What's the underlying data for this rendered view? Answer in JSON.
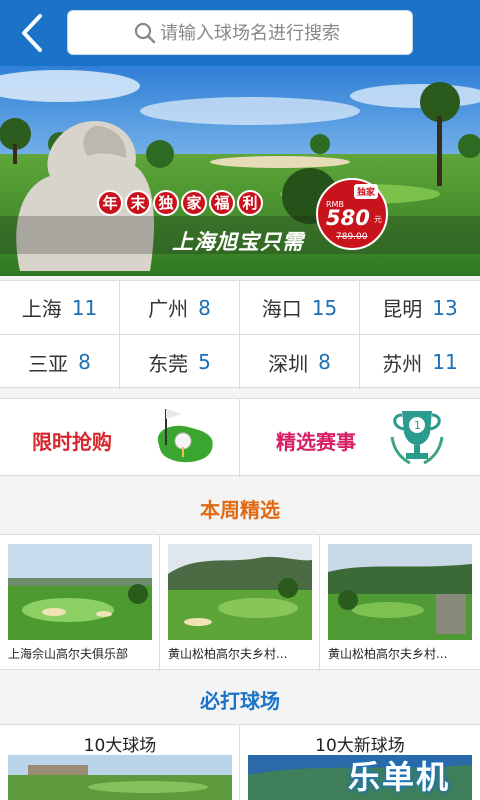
{
  "header": {
    "search_placeholder": "请输入球场名进行搜索"
  },
  "banner": {
    "promo_chars": [
      "年",
      "末",
      "独",
      "家",
      "福",
      "利"
    ],
    "subtitle": "上海旭宝只需",
    "badge_tag": "独家",
    "currency": "RMB",
    "price": "580",
    "unit": "元",
    "old_price": "789.00"
  },
  "cities": [
    {
      "name": "上海",
      "count": "11"
    },
    {
      "name": "广州",
      "count": "8"
    },
    {
      "name": "海口",
      "count": "15"
    },
    {
      "name": "昆明",
      "count": "13"
    },
    {
      "name": "三亚",
      "count": "8"
    },
    {
      "name": "东莞",
      "count": "5"
    },
    {
      "name": "深圳",
      "count": "8"
    },
    {
      "name": "苏州",
      "count": "11"
    }
  ],
  "features": {
    "flash_sale": "限时抢购",
    "featured_events": "精选赛事"
  },
  "weekly": {
    "title": "本周精选",
    "cards": [
      {
        "caption": "上海佘山高尔夫俱乐部"
      },
      {
        "caption": "黄山松柏高尔夫乡村..."
      },
      {
        "caption": "黄山松柏高尔夫乡村..."
      }
    ]
  },
  "must_play": {
    "title": "必打球场",
    "col1": "10大球场",
    "col2": "10大新球场"
  },
  "watermark": "乐单机",
  "colors": {
    "header_blue": "#1a73c6",
    "accent_orange": "#e06a14",
    "flash_red": "#d7262e",
    "event_pink": "#d61f66"
  }
}
